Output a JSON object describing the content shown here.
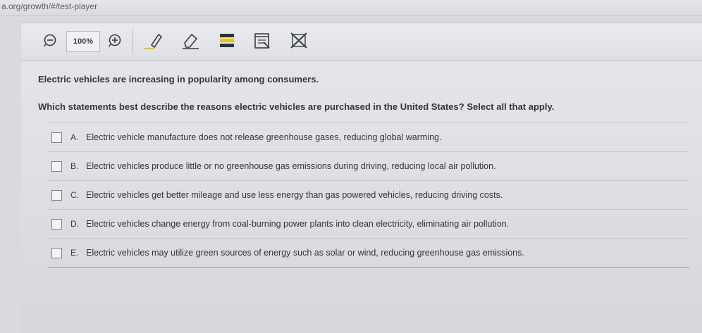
{
  "browser": {
    "url": "a.org/growth/#/test-player"
  },
  "toolbar": {
    "zoom_out_icon": "zoom-out-icon",
    "zoom_value": "100%",
    "zoom_in_icon": "zoom-in-icon",
    "tools": [
      "pencil-icon",
      "eraser-icon",
      "highlighter-icon",
      "notepad-icon",
      "cross-out-icon"
    ]
  },
  "question": {
    "stem": "Electric vehicles are increasing in popularity among consumers.",
    "prompt": "Which statements best describe the reasons electric vehicles are purchased in the United States? Select all that apply.",
    "options": [
      {
        "letter": "A.",
        "text": "Electric vehicle manufacture does not release greenhouse gases, reducing global warming.",
        "checked": false
      },
      {
        "letter": "B.",
        "text": "Electric vehicles produce little or no greenhouse gas emissions during driving, reducing local air pollution.",
        "checked": false
      },
      {
        "letter": "C.",
        "text": "Electric vehicles get better mileage and use less energy than gas powered vehicles, reducing driving costs.",
        "checked": false
      },
      {
        "letter": "D.",
        "text": "Electric vehicles change energy from coal-burning power plants into clean electricity, eliminating air pollution.",
        "checked": false
      },
      {
        "letter": "E.",
        "text": "Electric vehicles may utilize green sources of energy such as solar or wind, reducing greenhouse gas emissions.",
        "checked": false
      }
    ]
  },
  "colors": {
    "toolbar_icon": "#3a3d44",
    "highlighter_yellow": "#e6c700",
    "highlighter_band": "#2f3238"
  }
}
